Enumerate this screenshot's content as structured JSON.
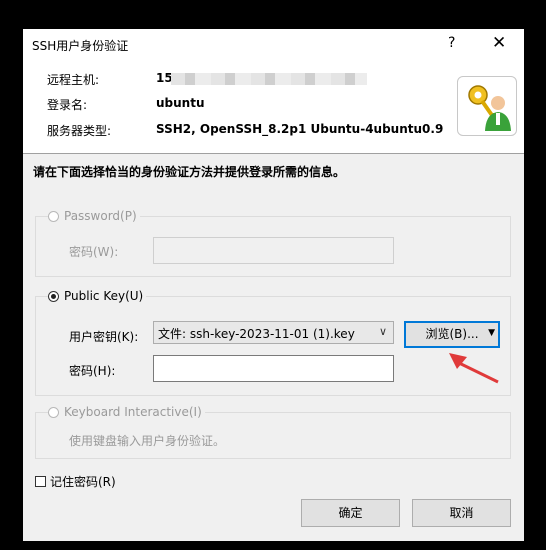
{
  "window": {
    "title": "SSH用户身份验证",
    "help_label": "?",
    "close_label": "✕"
  },
  "info": {
    "host_label": "远程主机:",
    "host_value": "15.",
    "login_label": "登录名:",
    "login_value": "ubuntu",
    "server_type_label": "服务器类型:",
    "server_type_value": "SSH2, OpenSSH_8.2p1 Ubuntu-4ubuntu0.9",
    "logo_icon": "user-key-icon"
  },
  "instruction": "请在下面选择恰当的身份验证方法并提供登录所需的信息。",
  "password_group": {
    "label": "Password(P)",
    "password_field_label": "密码(W):",
    "enabled": false
  },
  "publickey_group": {
    "label": "Public Key(U)",
    "selected": true,
    "user_key_label": "用户密钥(K):",
    "user_key_value": "文件: ssh-key-2023-11-01 (1).key",
    "browse_label": "浏览(B)...",
    "password_field_label": "密码(H):",
    "password_value": ""
  },
  "keyboard_group": {
    "label": "Keyboard Interactive(I)",
    "description": "使用键盘输入用户身份验证。",
    "enabled": false
  },
  "remember_password_label": "记住密码(R)",
  "buttons": {
    "ok_label": "确定",
    "cancel_label": "取消"
  },
  "colors": {
    "annotation_arrow": "#e03a3a",
    "focus_border": "#0078d7"
  }
}
